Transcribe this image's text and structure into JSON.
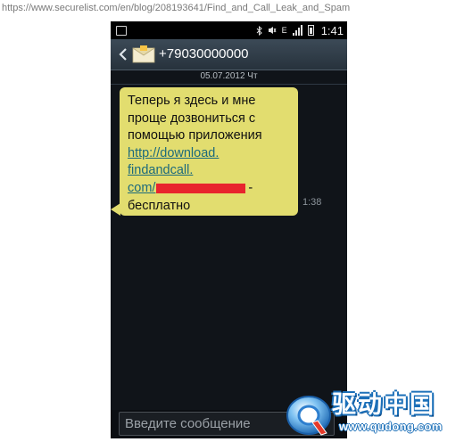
{
  "browser": {
    "url": "https://www.securelist.com/en/blog/208193641/Find_and_Call_Leak_and_Spam"
  },
  "status_bar": {
    "time": "1:41",
    "icons": [
      "bluetooth-icon",
      "mute-icon",
      "network-e-icon",
      "signal-icon",
      "battery-icon"
    ],
    "network_label": "E"
  },
  "header": {
    "contact": "+79030000000",
    "icons": [
      "back-icon",
      "envelope-icon"
    ]
  },
  "conversation": {
    "date": "05.07.2012 Чт",
    "message": {
      "line1": "Теперь я здесь и мне",
      "line2": "проще дозвониться с",
      "line3": "помощью приложения",
      "link1": "http://download.",
      "link2": "findandcall.",
      "link3": "com/",
      "suffix": "-",
      "line_last": "бесплатно",
      "time": "1:38"
    }
  },
  "composer": {
    "placeholder": "Введите сообщение"
  },
  "watermark": {
    "title": "驱动中国",
    "url": "www.qudong.com"
  },
  "colors": {
    "bubble": "#e2dd6f",
    "link": "#1c6a7c",
    "redaction": "#e8242d",
    "screen_bg": "#101419"
  }
}
